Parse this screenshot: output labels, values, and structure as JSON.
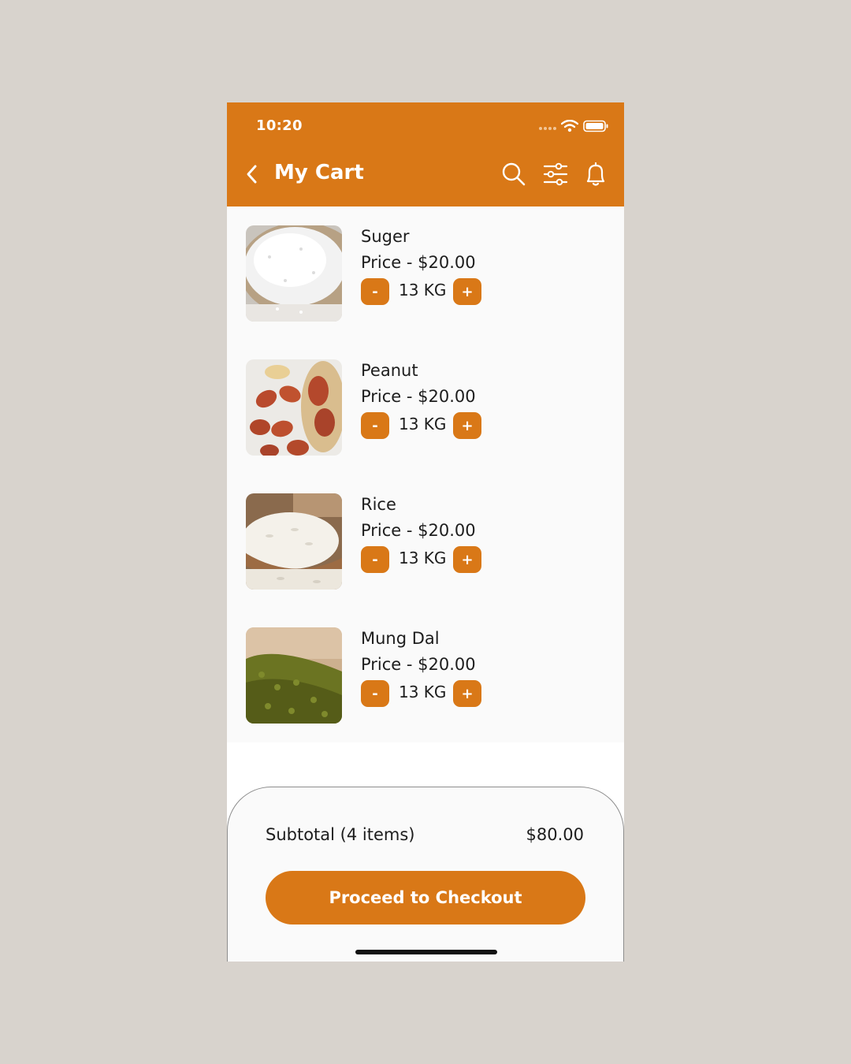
{
  "status_bar": {
    "time": "10:20"
  },
  "header": {
    "title": "My Cart",
    "icons": [
      "chevron-left-icon",
      "search-icon",
      "filter-sliders-icon",
      "bell-icon"
    ]
  },
  "cart_items": [
    {
      "name": "Suger",
      "price": "Price - $20.00",
      "quantity": "13 KG",
      "image": "sugar-photo"
    },
    {
      "name": "Peanut",
      "price": "Price - $20.00",
      "quantity": "13 KG",
      "image": "peanut-photo"
    },
    {
      "name": "Rice",
      "price": "Price - $20.00",
      "quantity": "13 KG",
      "image": "rice-photo"
    },
    {
      "name": "Mung Dal",
      "price": "Price - $20.00",
      "quantity": "13 KG",
      "image": "mung-dal-photo"
    }
  ],
  "controls": {
    "minus": "-",
    "plus": "+"
  },
  "summary": {
    "subtotal_label": "Subtotal (4 items)",
    "subtotal_value": "$80.00",
    "checkout_label": "Proceed to Checkout"
  },
  "colors": {
    "accent": "#d97817",
    "page_background": "#d8d3cd",
    "surface": "#fafafa",
    "text": "#1d1d1d"
  }
}
